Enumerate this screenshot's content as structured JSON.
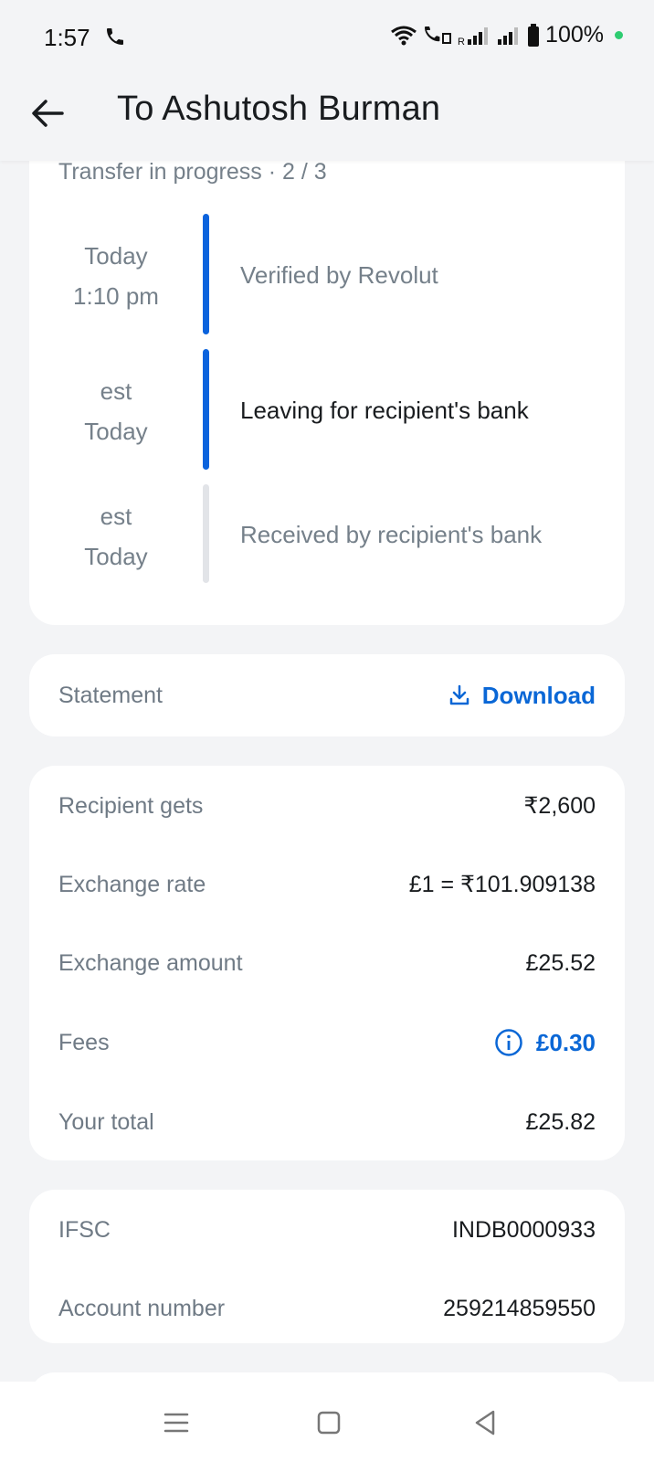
{
  "status_bar": {
    "time": "1:57",
    "battery": "100%"
  },
  "header": {
    "title": "To Ashutosh Burman"
  },
  "transfer": {
    "heading": "Transfer in progress · 2 / 3",
    "steps": [
      {
        "time_line1": "Today",
        "time_line2": "1:10 pm",
        "label": "Verified by Revolut",
        "state": "done"
      },
      {
        "time_line1": "est",
        "time_line2": "Today",
        "label": "Leaving for recipient's bank",
        "state": "current"
      },
      {
        "time_line1": "est",
        "time_line2": "Today",
        "label": "Received by recipient's bank",
        "state": "pending"
      }
    ]
  },
  "statement": {
    "label": "Statement",
    "action": "Download"
  },
  "details": {
    "recipient_gets": {
      "label": "Recipient gets",
      "value": "₹2,600"
    },
    "exchange_rate": {
      "label": "Exchange rate",
      "value": "£1 = ₹101.909138"
    },
    "exchange_amount": {
      "label": "Exchange amount",
      "value": "£25.52"
    },
    "fees": {
      "label": "Fees",
      "value": "£0.30"
    },
    "total": {
      "label": "Your total",
      "value": "£25.82"
    }
  },
  "bank": {
    "ifsc": {
      "label": "IFSC",
      "value": "INDB0000933"
    },
    "account": {
      "label": "Account number",
      "value": "259214859550"
    }
  },
  "colors": {
    "accent": "#0a67d6",
    "done_bar": "#0b63dd",
    "pending_bar": "#e2e4e8"
  }
}
